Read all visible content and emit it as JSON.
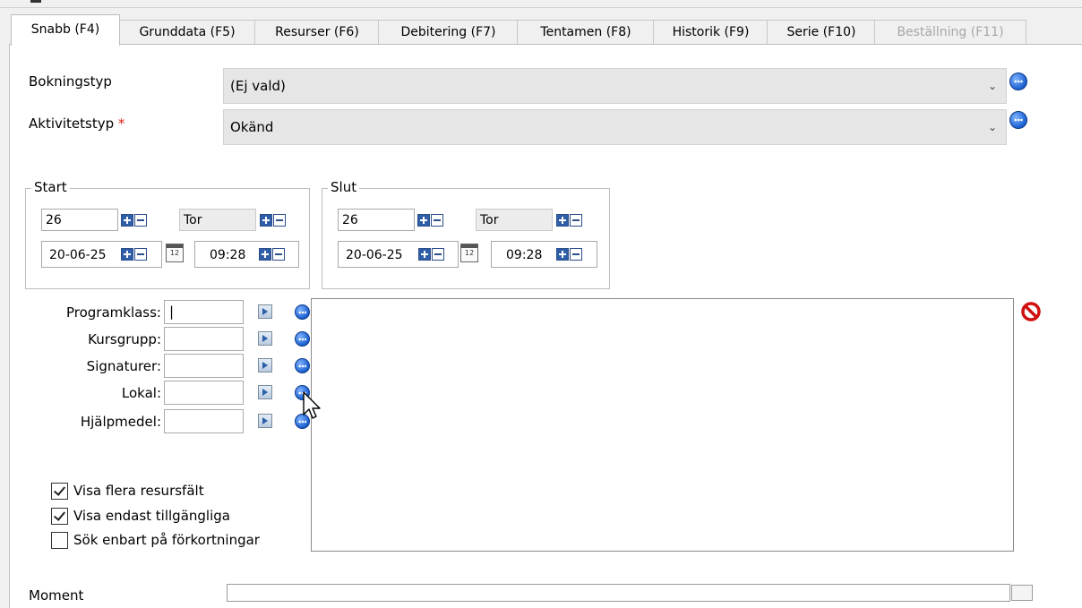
{
  "tabs": [
    {
      "label": "Snabb (F4)",
      "state": "active"
    },
    {
      "label": "Grunddata (F5)",
      "state": "normal"
    },
    {
      "label": "Resurser (F6)",
      "state": "normal"
    },
    {
      "label": "Debitering (F7)",
      "state": "normal"
    },
    {
      "label": "Tentamen (F8)",
      "state": "normal"
    },
    {
      "label": "Historik (F9)",
      "state": "normal"
    },
    {
      "label": "Serie (F10)",
      "state": "normal"
    },
    {
      "label": "Beställning (F11)",
      "state": "disabled"
    }
  ],
  "form": {
    "booking_type": {
      "label": "Bokningstyp",
      "value": "(Ej vald)"
    },
    "activity_type": {
      "label": "Aktivitetstyp",
      "required_mark": "*",
      "value": "Okänd"
    }
  },
  "start": {
    "title": "Start",
    "day": "26",
    "weekday": "Tor",
    "date": "20-06-25",
    "time": "09:28"
  },
  "end": {
    "title": "Slut",
    "day": "26",
    "weekday": "Tor",
    "date": "20-06-25",
    "time": "09:28"
  },
  "calendar_icon_text": "12",
  "resources": {
    "fields": [
      {
        "label": "Programklass:",
        "value": "|"
      },
      {
        "label": "Kursgrupp:",
        "value": ""
      },
      {
        "label": "Signaturer:",
        "value": ""
      },
      {
        "label": "Lokal:",
        "value": ""
      },
      {
        "label": "Hjälpmedel:",
        "value": ""
      }
    ]
  },
  "options": [
    {
      "label": "Visa flera resursfält",
      "checked": true
    },
    {
      "label": "Visa endast tillgängliga",
      "checked": true
    },
    {
      "label": "Sök enbart på förkortningar",
      "checked": false
    }
  ],
  "moment": {
    "label": "Moment"
  },
  "colors": {
    "required": "#e0201b",
    "accent": "#1a5fd0",
    "panel": "#ffffff",
    "window": "#f0f0f0"
  }
}
